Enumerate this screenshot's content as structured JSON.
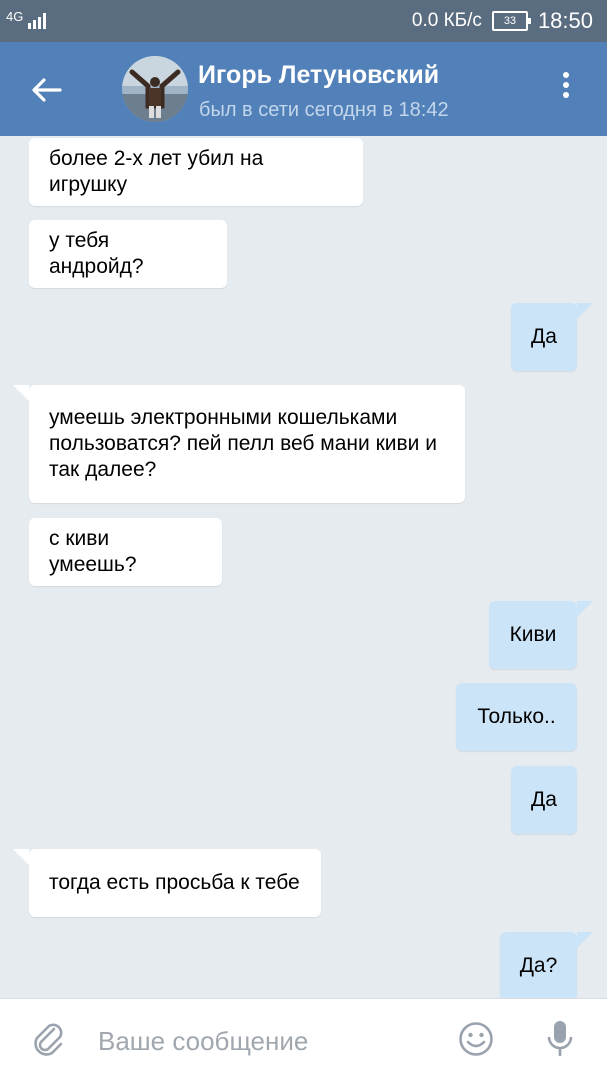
{
  "status_bar": {
    "network": "4G",
    "speed": "0.0 КБ/с",
    "battery": "33",
    "time": "18:50"
  },
  "header": {
    "name": "Игорь Летуновский",
    "status": "был в сети сегодня в 18:42"
  },
  "messages": [
    {
      "dir": "in",
      "text": "более 2-х лет убил на игрушку"
    },
    {
      "dir": "in",
      "text": "у тебя андройд?"
    },
    {
      "dir": "out",
      "text": "Да"
    },
    {
      "dir": "in",
      "text": "умеешь электронными кошельками пользоватся? пей пелл веб мани киви и так далее?"
    },
    {
      "dir": "in",
      "text": "с киви умеешь?"
    },
    {
      "dir": "out",
      "text": "Киви"
    },
    {
      "dir": "out",
      "text": "Только.."
    },
    {
      "dir": "out",
      "text": "Да"
    },
    {
      "dir": "in",
      "text": "тогда есть просьба к тебе"
    },
    {
      "dir": "out",
      "text": "Да?"
    }
  ],
  "composer": {
    "placeholder": "Ваше сообщение"
  },
  "colors": {
    "header": "#5181b8",
    "status_bar": "#5a6c80",
    "chat_background": "#e6ebf0",
    "incoming_bubble": "#ffffff",
    "outgoing_bubble": "#cce4f7"
  }
}
